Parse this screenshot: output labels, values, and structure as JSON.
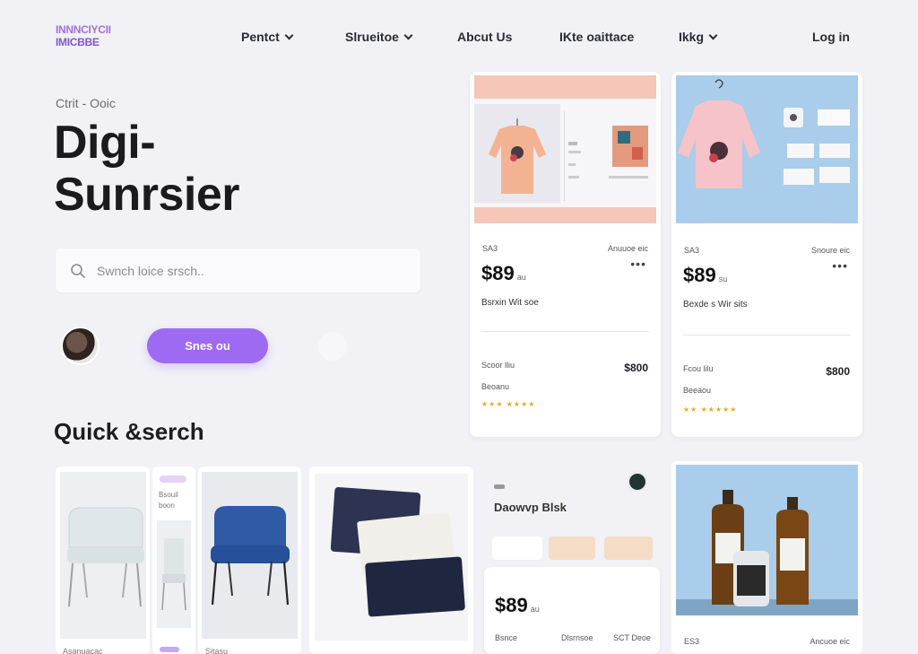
{
  "header": {
    "logo_line1": "ΙΝΝΝϹΙΥϹΙΙ",
    "logo_line2": "ΙΜΙϹΒΒΕ",
    "nav": [
      {
        "label": "Pentct",
        "has_menu": true
      },
      {
        "label": "Slrueitoe",
        "has_menu": true
      },
      {
        "label": "Abcut Us",
        "has_menu": false
      },
      {
        "label": "IKte oaittace",
        "has_menu": false
      },
      {
        "label": "Ikkg",
        "has_menu": true
      }
    ],
    "login_label": "Log in"
  },
  "hero": {
    "breadcrumb": "Ctrit - Ooic",
    "title_line1": "Digi-",
    "title_line2": "Sunrsier",
    "search_placeholder": "Swnch loice srsch..",
    "cta_label": "Snes ou"
  },
  "section": {
    "title": "Quick &serch"
  },
  "products": [
    {
      "tag": "SA3",
      "meta": "Anuuoe eic",
      "price": "$89",
      "price_unit": "au",
      "name": "Bsrxin Wit soe",
      "row_label": "Scoor lliu",
      "row_value": "$800",
      "sub_label": "Beoanu"
    },
    {
      "tag": "SA3",
      "meta": "Snoure eic",
      "price": "$89",
      "price_unit": "su",
      "name": "Bexde s Wir sits",
      "row_label": "Fcou lilu",
      "row_value": "$800",
      "sub_label": "Beeaou"
    }
  ],
  "bottom": {
    "chair_caption": "Asanuacac",
    "chair_small_caption": "Bsouil boon",
    "chair2_caption": "Sitasu",
    "promo_title": "Daowvp Blsk",
    "promo_price": "$89",
    "promo_unit": "au",
    "promo_cols": [
      "Bsnce",
      "Dlsrnsoe",
      "SCT Deoe"
    ],
    "bottle_caption": "ES3",
    "bottle_meta": "Ancuoe eic"
  },
  "colors": {
    "accent": "#9e6af2",
    "background": "#f1f1f6",
    "peach": "#f4c7b8",
    "sky": "#a9cdeb"
  }
}
